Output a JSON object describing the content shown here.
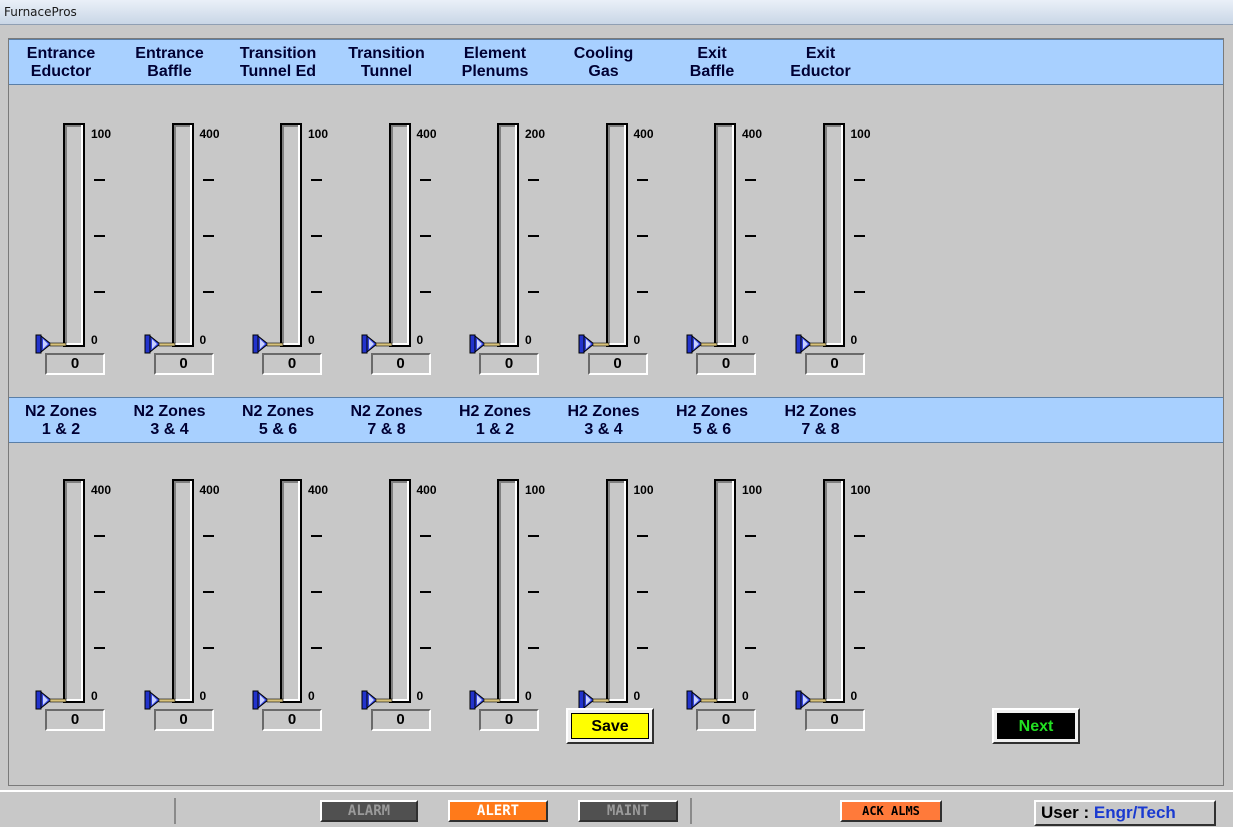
{
  "window": {
    "title": "FurnacePros"
  },
  "top_row": {
    "labels": [
      {
        "line1": "Entrance",
        "line2": "Eductor"
      },
      {
        "line1": "Entrance",
        "line2": "Baffle"
      },
      {
        "line1": "Transition",
        "line2": "Tunnel Ed"
      },
      {
        "line1": "Transition",
        "line2": "Tunnel"
      },
      {
        "line1": "Element",
        "line2": "Plenums"
      },
      {
        "line1": "Cooling",
        "line2": "Gas"
      },
      {
        "line1": "Exit",
        "line2": "Baffle"
      },
      {
        "line1": "Exit",
        "line2": "Eductor"
      }
    ],
    "gauges": [
      {
        "max": "100",
        "min": "0",
        "value": "0"
      },
      {
        "max": "400",
        "min": "0",
        "value": "0"
      },
      {
        "max": "100",
        "min": "0",
        "value": "0"
      },
      {
        "max": "400",
        "min": "0",
        "value": "0"
      },
      {
        "max": "200",
        "min": "0",
        "value": "0"
      },
      {
        "max": "400",
        "min": "0",
        "value": "0"
      },
      {
        "max": "400",
        "min": "0",
        "value": "0"
      },
      {
        "max": "100",
        "min": "0",
        "value": "0"
      }
    ]
  },
  "bottom_row": {
    "labels": [
      {
        "line1": "N2 Zones",
        "line2": "1 & 2"
      },
      {
        "line1": "N2 Zones",
        "line2": "3 & 4"
      },
      {
        "line1": "N2 Zones",
        "line2": "5 & 6"
      },
      {
        "line1": "N2 Zones",
        "line2": "7 & 8"
      },
      {
        "line1": "H2 Zones",
        "line2": "1 & 2"
      },
      {
        "line1": "H2 Zones",
        "line2": "3 & 4"
      },
      {
        "line1": "H2 Zones",
        "line2": "5 & 6"
      },
      {
        "line1": "H2 Zones",
        "line2": "7 & 8"
      }
    ],
    "gauges": [
      {
        "max": "400",
        "min": "0",
        "value": "0"
      },
      {
        "max": "400",
        "min": "0",
        "value": "0"
      },
      {
        "max": "400",
        "min": "0",
        "value": "0"
      },
      {
        "max": "400",
        "min": "0",
        "value": "0"
      },
      {
        "max": "100",
        "min": "0",
        "value": "0"
      },
      {
        "max": "100",
        "min": "0",
        "value": "0"
      },
      {
        "max": "100",
        "min": "0",
        "value": "0"
      },
      {
        "max": "100",
        "min": "0",
        "value": "0"
      }
    ]
  },
  "buttons": {
    "save": "Save",
    "next": "Next"
  },
  "status_bar": {
    "alarm": "ALARM",
    "alert": "ALERT",
    "maint": "MAINT",
    "ack": "ACK ALMS",
    "user_label": "User : ",
    "user_value": "Engr/Tech"
  },
  "colors": {
    "header_band": "#a8d0ff",
    "save_fill": "#ffff00",
    "next_text": "#22e022",
    "alert_fill": "#ff7a1a",
    "ack_fill": "#ff7a3a",
    "user_value": "#1a3ad0",
    "pointer": "#2233cc"
  }
}
